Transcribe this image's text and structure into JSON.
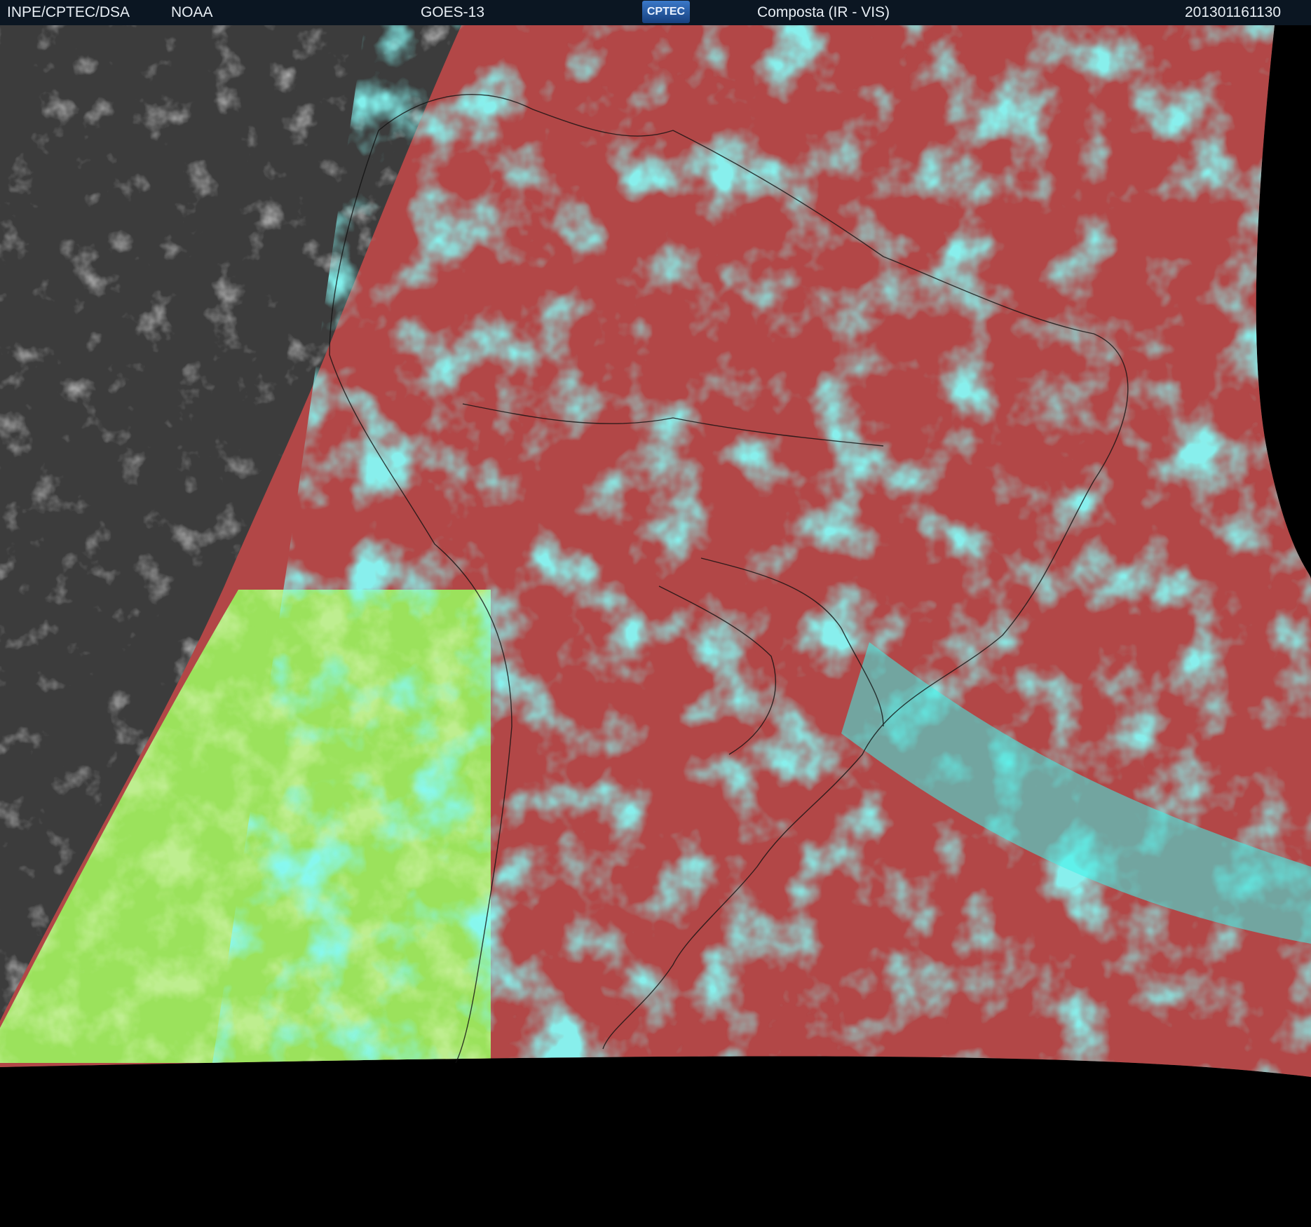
{
  "header": {
    "org": "INPE/CPTEC/DSA",
    "agency": "NOAA",
    "satellite": "GOES-13",
    "logo_text": "CPTEC",
    "product": "Composta (IR - VIS)",
    "timestamp": "201301161130"
  },
  "colors": {
    "header_bg": "#0b1622",
    "header_text": "#e8eef4",
    "space": "#000000",
    "ir_night": "#3c3c3c",
    "land_clear": "#b24747",
    "low_cloud": "#9be25c",
    "high_cloud": "#3ef2ea",
    "border_lines": "#111111"
  }
}
